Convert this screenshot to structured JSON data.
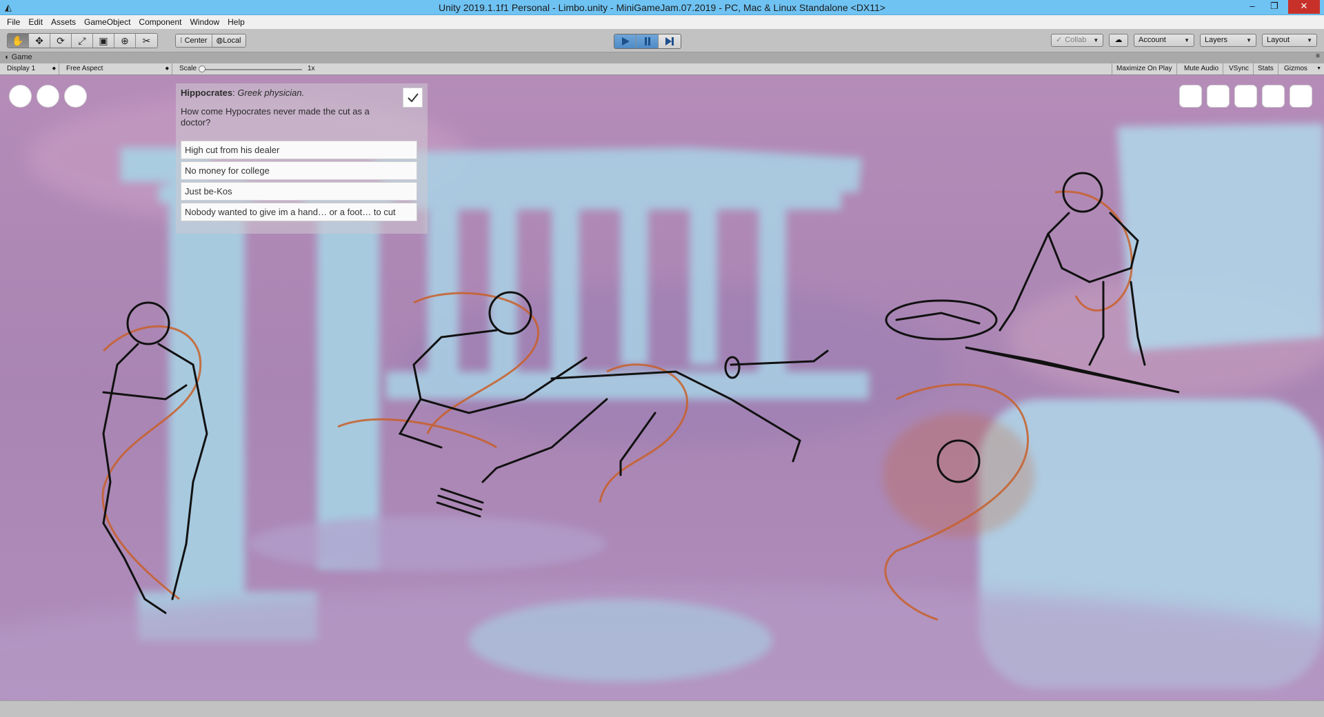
{
  "window": {
    "title": "Unity 2019.1.1f1 Personal - Limbo.unity - MiniGameJam.07.2019 - PC, Mac & Linux Standalone <DX11>",
    "icon": "unity-logo-icon",
    "minimize": "–",
    "restore": "❐",
    "close": "✕"
  },
  "menu": [
    "File",
    "Edit",
    "Assets",
    "GameObject",
    "Component",
    "Window",
    "Help"
  ],
  "toolbar": {
    "tools": [
      {
        "name": "hand-tool-icon",
        "glyph": "✋"
      },
      {
        "name": "move-tool-icon",
        "glyph": "✥"
      },
      {
        "name": "rotate-tool-icon",
        "glyph": "⟳"
      },
      {
        "name": "scale-tool-icon",
        "glyph": "⤢"
      },
      {
        "name": "rect-tool-icon",
        "glyph": "▣"
      },
      {
        "name": "transform-tool-icon",
        "glyph": "⊕"
      },
      {
        "name": "custom-tool-icon",
        "glyph": "✂"
      }
    ],
    "pivot": {
      "center": "Center",
      "local": "Local"
    },
    "collab": "Collab",
    "account": "Account",
    "layers": "Layers",
    "layout": "Layout"
  },
  "game_tab": {
    "label": "Game",
    "display": "Display 1",
    "aspect": "Free Aspect",
    "scale_label": "Scale",
    "scale_value": "1x",
    "maximize": "Maximize On Play",
    "mute": "Mute Audio",
    "vsync": "VSync",
    "stats": "Stats",
    "gizmos": "Gizmos"
  },
  "dialog": {
    "speaker": "Hippocrates",
    "speaker_desc": "Greek physician.",
    "question": "How come Hypocrates never made the cut as a doctor?",
    "answers": [
      "High cut from his dealer",
      "No money for college",
      "Just be-Kos",
      "Nobody wanted to give im a hand… or a foot… to cut"
    ]
  },
  "colors": {
    "titlebar": "#6fc3f3",
    "play_active": "#4f8bc6",
    "scene_bg": "#b78fb8",
    "sketch_orange": "#c8602a",
    "stone_blue": "#a9d3e6"
  }
}
